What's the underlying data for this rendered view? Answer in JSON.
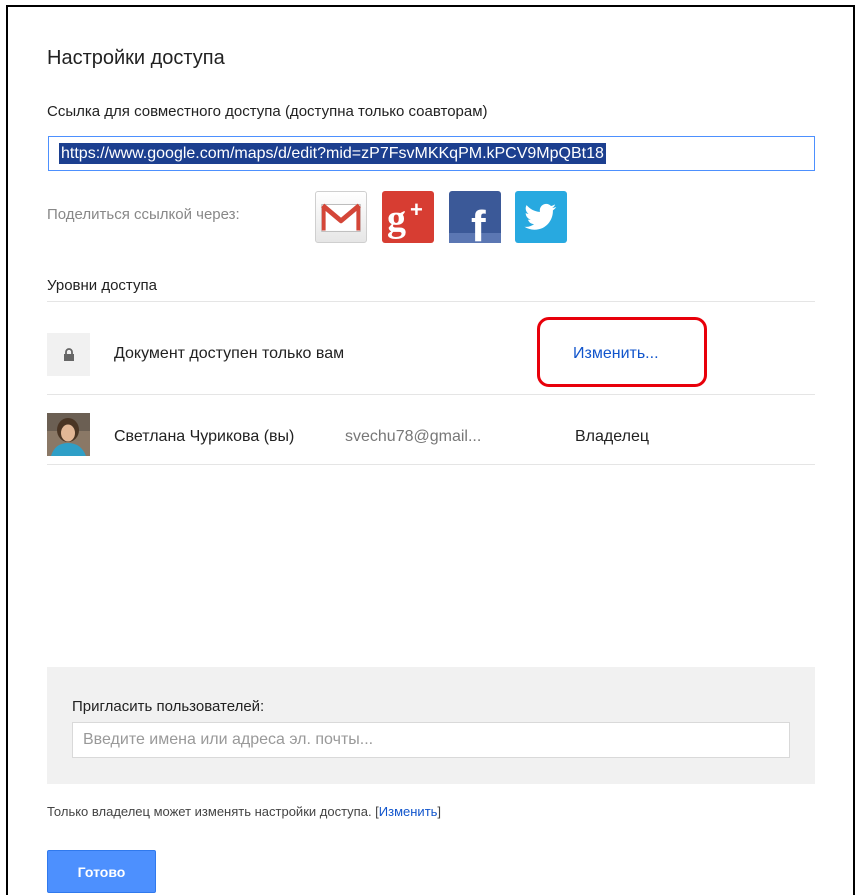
{
  "dialog": {
    "title": "Настройки доступа",
    "link_label": "Ссылка для совместного доступа (доступна только соавторам)",
    "link_value": "https://www.google.com/maps/d/edit?mid=zP7FsvMKKqPM.kPCV9MpQBt18",
    "share_label": "Поделиться ссылкой через:",
    "share_buttons": [
      {
        "name": "gmail-icon",
        "color": "#d44638"
      },
      {
        "name": "google-plus-icon",
        "color": "#d73d32"
      },
      {
        "name": "facebook-icon",
        "color": "#3b5998"
      },
      {
        "name": "twitter-icon",
        "color": "#28a9e0"
      }
    ],
    "levels_label": "Уровни доступа",
    "access": {
      "icon": "lock-icon",
      "text": "Документ доступен только вам",
      "change_label": "Изменить..."
    },
    "user": {
      "name": "Светлана Чурикова (вы)",
      "email": "svechu78@gmail...",
      "role": "Владелец"
    },
    "invite": {
      "label": "Пригласить пользователей:",
      "placeholder": "Введите имена или адреса эл. почты..."
    },
    "footer": {
      "note_prefix": "Только владелец может изменять настройки доступа. [",
      "note_link": "Изменить",
      "note_suffix": "]"
    },
    "done_label": "Готово",
    "accent_color": "#4d90fe",
    "highlight_color": "#e8000a"
  }
}
